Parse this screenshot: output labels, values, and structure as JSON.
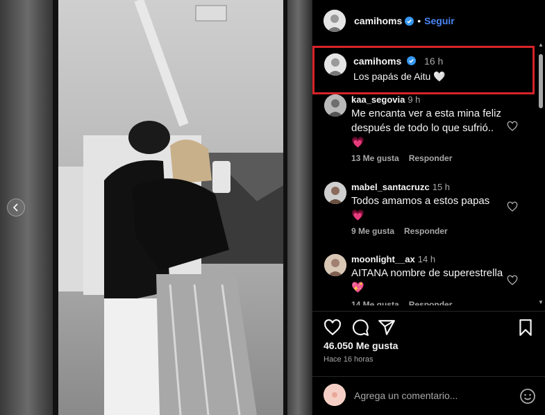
{
  "post": {
    "author": "camihoms",
    "follow_label": "Seguir",
    "separator": "•"
  },
  "caption": {
    "author": "camihoms",
    "time": "16 h",
    "text": "Los papás de Aitu 🤍"
  },
  "comments": [
    {
      "user": "kaa_segovia",
      "time": "9 h",
      "text": "Me encanta ver a esta mina feliz después de todo lo que sufrió..💗",
      "likes": "13 Me gusta",
      "reply": "Responder"
    },
    {
      "user": "mabel_santacruzc",
      "time": "15 h",
      "text": "Todos amamos a estos papas 💗",
      "likes": "9 Me gusta",
      "reply": "Responder"
    },
    {
      "user": "moonlight__ax",
      "time": "14 h",
      "text": "AITANA nombre de superestrella💖",
      "likes": "14 Me gusta",
      "reply": "Responder"
    }
  ],
  "stats": {
    "likes": "46.050 Me gusta",
    "ago": "Hace 16 horas"
  },
  "composer": {
    "placeholder": "Agrega un comentario..."
  },
  "icons": {
    "verified": "verified-badge-icon",
    "heart": "heart-icon",
    "comment": "comment-icon",
    "share": "share-icon",
    "save": "bookmark-icon",
    "emoji": "emoji-icon",
    "prev": "chevron-left-icon"
  },
  "colors": {
    "accent": "#4a86f7",
    "highlight": "#d8232a",
    "muted": "#a8a8a8"
  }
}
